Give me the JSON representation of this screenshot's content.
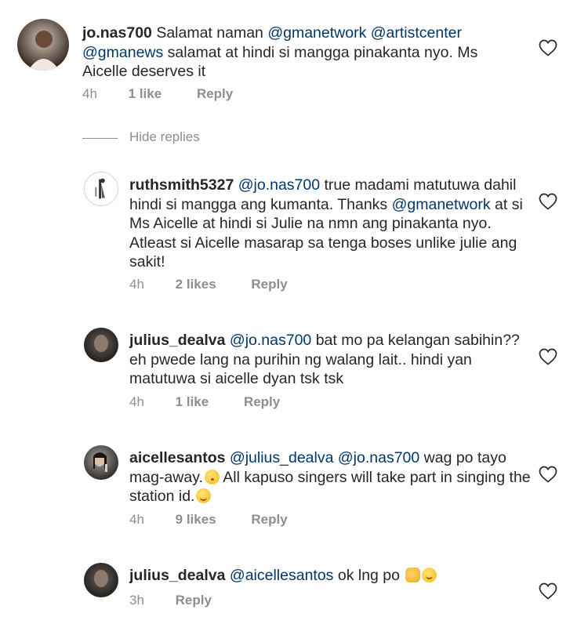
{
  "hide_replies_label": "Hide replies",
  "icons": {
    "like": "heart-outline-icon"
  },
  "comments": [
    {
      "username": "jo.nas700",
      "text_before": "Salamat naman ",
      "mentions1": "@gmanetwork @artistcenter @gmanews",
      "text_after": " salamat at hindi si mangga pinakanta nyo. Ms Aicelle deserves it",
      "time": "4h",
      "likes": "1 like",
      "reply": "Reply"
    },
    {
      "username": "ruthsmith5327",
      "mention_a": "@jo.nas700",
      "text_a": " true madami matutuwa dahil hindi si mangga ang kumanta. Thanks ",
      "mention_b": "@gmanetwork",
      "text_b": " at si Ms Aicelle at hindi si Julie na nmn ang pinakanta nyo. Atleast si Aicelle masarap sa tenga boses unlike julie ang sakit!",
      "time": "4h",
      "likes": "2 likes",
      "reply": "Reply"
    },
    {
      "username": "julius_dealva",
      "mention_a": "@jo.nas700",
      "text_a": " bat mo pa kelangan sabihin?? eh pwede lang na purihin ng walang lait.. hindi yan matutuwa si aicelle dyan tsk tsk",
      "time": "4h",
      "likes": "1 like",
      "reply": "Reply"
    },
    {
      "username": "aicellesantos",
      "mention_a": "@julius_dealva @jo.nas700",
      "text_a": " wag po tayo mag-away.",
      "text_b": " All kapuso singers will take part in singing the station id.",
      "time": "4h",
      "likes": "9 likes",
      "reply": "Reply"
    },
    {
      "username": "julius_dealva",
      "mention_a": "@aicellesantos",
      "text_a": " ok lng po ",
      "time": "3h",
      "reply": "Reply"
    }
  ]
}
